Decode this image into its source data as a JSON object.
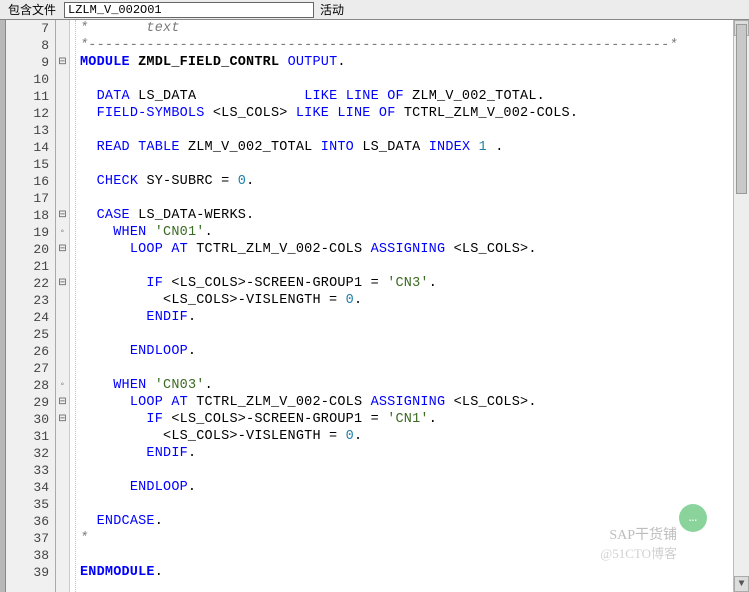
{
  "toolbar": {
    "label": "包含文件",
    "input_value": "LZLM_V_002O01",
    "status": "活动"
  },
  "watermarks": {
    "line1": "SAP干货铺",
    "line2": "@51CTO博客"
  },
  "lines": [
    {
      "n": 7,
      "fold": "",
      "html": "<span class='cmt'>*       text</span>"
    },
    {
      "n": 8,
      "fold": "",
      "html": "<span class='cmt'>*----------------------------------------------------------------------*</span>"
    },
    {
      "n": 9,
      "fold": "⊟",
      "html": "<span class='kw'>MODULE</span> <span class='nm'>ZMDL_FIELD_CONTRL</span> <span class='kw2'>OUTPUT</span><span class='id'>.</span>"
    },
    {
      "n": 10,
      "fold": "",
      "html": ""
    },
    {
      "n": 11,
      "fold": "",
      "html": "  <span class='kw2'>DATA</span> <span class='id'>LS_DATA            </span> <span class='kw2'>LIKE LINE OF</span> <span class='id'>ZLM_V_002_TOTAL.</span>"
    },
    {
      "n": 12,
      "fold": "",
      "html": "  <span class='kw2'>FIELD-SYMBOLS</span> <span class='id'>&lt;LS_COLS&gt;</span> <span class='kw2'>LIKE LINE OF</span> <span class='id'>TCTRL_ZLM_V_002-COLS.</span>"
    },
    {
      "n": 13,
      "fold": "",
      "html": ""
    },
    {
      "n": 14,
      "fold": "",
      "html": "  <span class='kw2'>READ TABLE</span> <span class='id'>ZLM_V_002_TOTAL</span> <span class='kw2'>INTO</span> <span class='id'>LS_DATA</span> <span class='kw2'>INDEX</span> <span class='num'>1</span> <span class='id'>.</span>"
    },
    {
      "n": 15,
      "fold": "",
      "html": ""
    },
    {
      "n": 16,
      "fold": "",
      "html": "  <span class='kw2'>CHECK</span> <span class='id'>SY-SUBRC =</span> <span class='num'>0</span><span class='id'>.</span>"
    },
    {
      "n": 17,
      "fold": "",
      "html": ""
    },
    {
      "n": 18,
      "fold": "⊟",
      "html": "  <span class='kw2'>CASE</span> <span class='id'>LS_DATA-WERKS.</span>"
    },
    {
      "n": 19,
      "fold": "◦",
      "html": "    <span class='kw2'>WHEN</span> <span class='str'>'CN01'</span><span class='id'>.</span>"
    },
    {
      "n": 20,
      "fold": "⊟",
      "html": "      <span class='kw2'>LOOP AT</span> <span class='id'>TCTRL_ZLM_V_002-COLS</span> <span class='kw2'>ASSIGNING</span> <span class='id'>&lt;LS_COLS&gt;.</span>"
    },
    {
      "n": 21,
      "fold": "",
      "html": ""
    },
    {
      "n": 22,
      "fold": "⊟",
      "html": "        <span class='kw2'>IF</span> <span class='id'>&lt;LS_COLS&gt;-SCREEN-GROUP1 =</span> <span class='str'>'CN3'</span><span class='id'>.</span>"
    },
    {
      "n": 23,
      "fold": "",
      "html": "          <span class='id'>&lt;LS_COLS&gt;-VISLENGTH =</span> <span class='num'>0</span><span class='id'>.</span>"
    },
    {
      "n": 24,
      "fold": "",
      "html": "        <span class='kw2'>ENDIF</span><span class='id'>.</span>"
    },
    {
      "n": 25,
      "fold": "",
      "html": ""
    },
    {
      "n": 26,
      "fold": "",
      "html": "      <span class='kw2'>ENDLOOP</span><span class='id'>.</span>"
    },
    {
      "n": 27,
      "fold": "",
      "html": ""
    },
    {
      "n": 28,
      "fold": "◦",
      "html": "    <span class='kw2'>WHEN</span> <span class='str'>'CN03'</span><span class='id'>.</span>"
    },
    {
      "n": 29,
      "fold": "⊟",
      "html": "      <span class='kw2'>LOOP AT</span> <span class='id'>TCTRL_ZLM_V_002-COLS</span> <span class='kw2'>ASSIGNING</span> <span class='id'>&lt;LS_COLS&gt;.</span>"
    },
    {
      "n": 30,
      "fold": "⊟",
      "html": "        <span class='kw2'>IF</span> <span class='id'>&lt;LS_COLS&gt;-SCREEN-GROUP1 =</span> <span class='str'>'CN1'</span><span class='id'>.</span>"
    },
    {
      "n": 31,
      "fold": "",
      "html": "          <span class='id'>&lt;LS_COLS&gt;-VISLENGTH =</span> <span class='num'>0</span><span class='id'>.</span>"
    },
    {
      "n": 32,
      "fold": "",
      "html": "        <span class='kw2'>ENDIF</span><span class='id'>.</span>"
    },
    {
      "n": 33,
      "fold": "",
      "html": ""
    },
    {
      "n": 34,
      "fold": "",
      "html": "      <span class='kw2'>ENDLOOP</span><span class='id'>.</span>"
    },
    {
      "n": 35,
      "fold": "",
      "html": ""
    },
    {
      "n": 36,
      "fold": "",
      "html": "  <span class='kw2'>ENDCASE</span><span class='id'>.</span>"
    },
    {
      "n": 37,
      "fold": "",
      "html": "<span class='cmt'>*</span>"
    },
    {
      "n": 38,
      "fold": "",
      "html": ""
    },
    {
      "n": 39,
      "fold": "",
      "html": "<span class='kw'>ENDMODULE</span><span class='id'>.</span>"
    }
  ]
}
